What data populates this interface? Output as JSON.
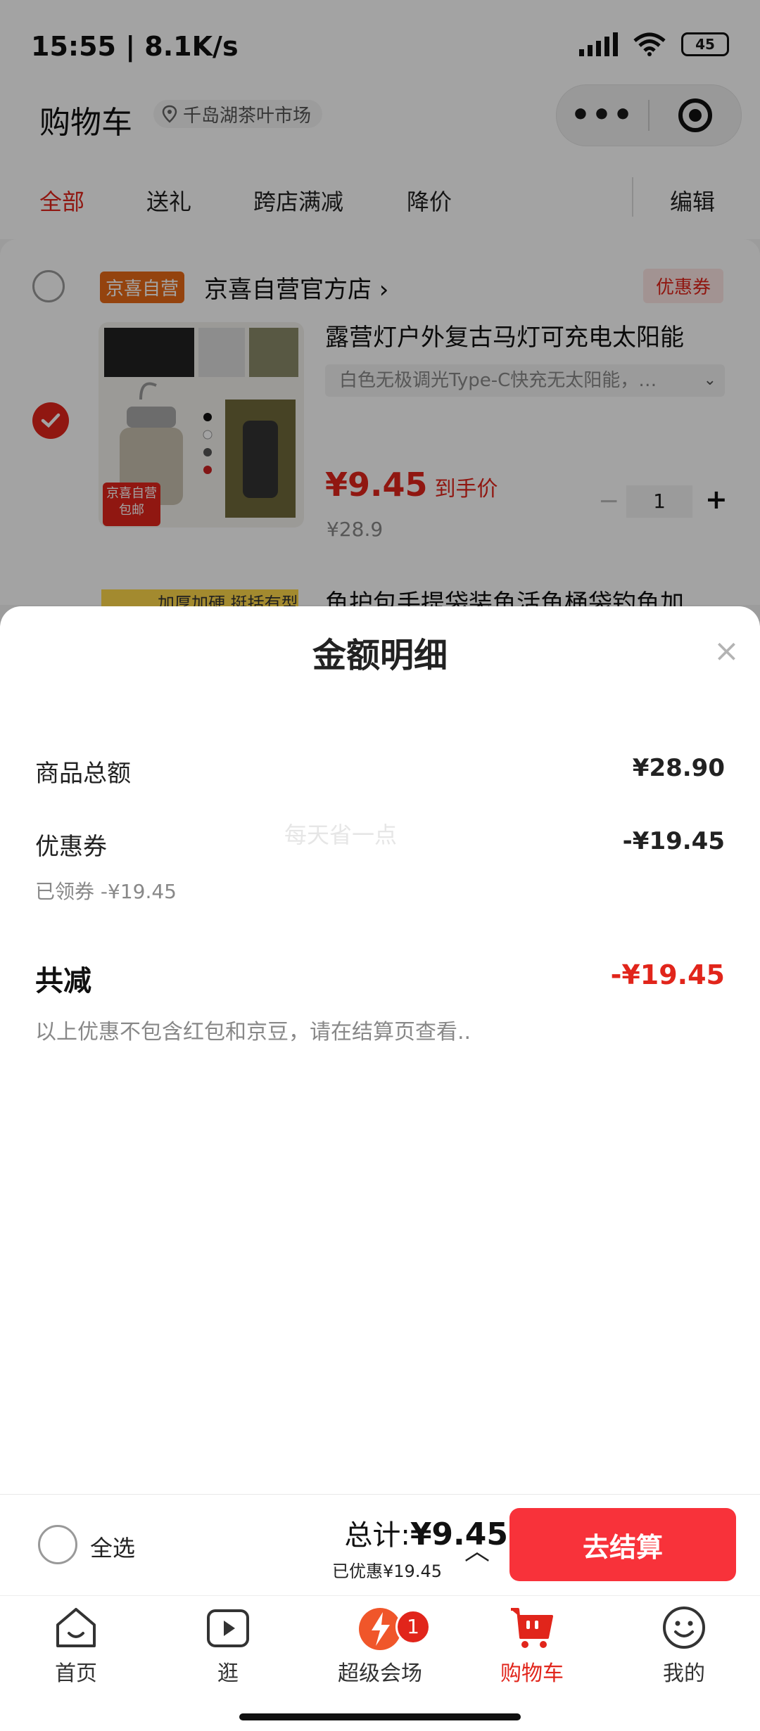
{
  "status_bar": {
    "time": "15:55 | 8.1K/s",
    "battery": "45"
  },
  "header": {
    "title": "购物车",
    "location": "千岛湖茶叶市场",
    "menu_dots": "•••"
  },
  "filters": {
    "tabs": [
      "全部",
      "送礼",
      "跨店满减",
      "降价"
    ],
    "edit_label": "编辑",
    "active_color": "#e1251b"
  },
  "shop": {
    "badge": "京喜自营",
    "name": "京喜自营官方店 ›",
    "coupon_tag": "优惠券"
  },
  "item": {
    "title": "露营灯户外复古马灯可充电太阳能",
    "spec": "白色无极调光Type-C快充无太阳能，…",
    "image_badge": "京喜自营\n包邮",
    "price_main": "¥9.45",
    "price_tail": "到手价",
    "original_price": "¥28.9",
    "quantity": "1",
    "minus": "−",
    "plus": "+",
    "checked": true
  },
  "next_item": {
    "badge": "加厚加硬 挺括有型",
    "title": "鱼护包手提袋装鱼活鱼桶袋钓鱼加"
  },
  "sheet": {
    "title": "金额明细",
    "close": "×",
    "rows": [
      {
        "label": "商品总额",
        "value": "¥28.90"
      },
      {
        "label": "优惠券",
        "value": "-¥19.45",
        "sub": "已领券 -¥19.45"
      }
    ],
    "watermark": "每天省一点",
    "total_reduce": {
      "label": "共减",
      "value": "-¥19.45"
    },
    "note": "以上优惠不包含红包和京豆，请在结算页查看.."
  },
  "checkout": {
    "select_all": "全选",
    "sum_label": "总计:",
    "sum_value": "¥9.45",
    "saved": "已优惠¥19.45",
    "button": "去结算",
    "button_color": "#f8323a"
  },
  "tabbar": {
    "items": [
      {
        "label": "首页",
        "icon": "home-icon"
      },
      {
        "label": "逛",
        "icon": "play-icon"
      },
      {
        "label": "超级会场",
        "icon": "venue-icon",
        "badge": "1"
      },
      {
        "label": "购物车",
        "icon": "cart-icon",
        "active": true
      },
      {
        "label": "我的",
        "icon": "smiley-icon"
      }
    ]
  }
}
